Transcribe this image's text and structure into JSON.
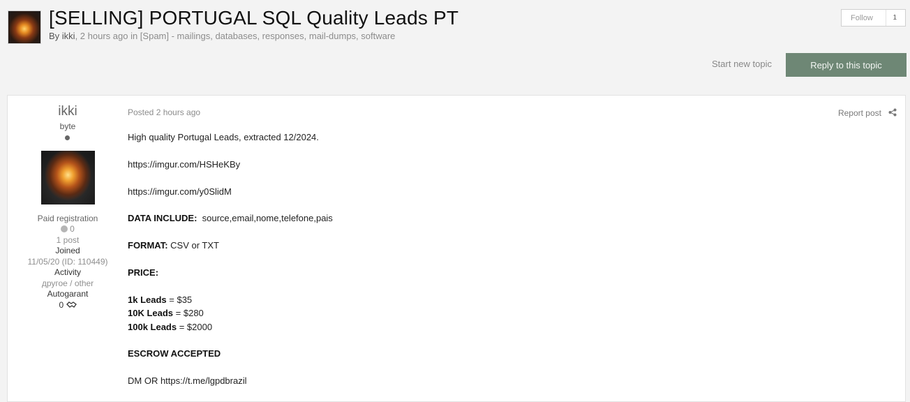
{
  "topic": {
    "title": "[SELLING] PORTUGAL SQL Quality Leads PT",
    "by": "By",
    "author": "ikki",
    "byline_rest": ", 2 hours ago in [Spam] - mailings, databases, responses, mail-dumps, software"
  },
  "follow": {
    "label": "Follow",
    "count": "1"
  },
  "actions": {
    "start_topic": "Start new topic",
    "reply": "Reply to this topic"
  },
  "post": {
    "author": {
      "name": "ikki",
      "rank": "byte",
      "registration": "Paid registration",
      "reputation": "0",
      "posts": "1 post",
      "joined_label": "Joined",
      "joined_value": "11/05/20 (ID: 110449)",
      "activity_label": "Activity",
      "activity_value": "другое / other",
      "autogarant_label": "Autogarant",
      "autogarant_value": "0"
    },
    "posted": "Posted 2 hours ago",
    "report": "Report post",
    "lines": {
      "intro": "High quality Portugal Leads, extracted 12/2024.",
      "link1": "https://imgur.com/HSHeKBy",
      "link2": "https://imgur.com/y0SlidM",
      "data_label": "DATA INCLUDE:",
      "data_value": "  source,email,nome,telefone,pais",
      "format_label": "FORMAT:",
      "format_value": " CSV or TXT",
      "price_label": "PRICE:",
      "p1_label": "1k Leads",
      "p1_value": " = $35",
      "p2_label": "10K Leads",
      "p2_value": " = $280",
      "p3_label": "100k Leads",
      "p3_value": " = $2000",
      "escrow": "ESCROW ACCEPTED",
      "dm": "DM OR https://t.me/lgpdbrazil"
    }
  }
}
